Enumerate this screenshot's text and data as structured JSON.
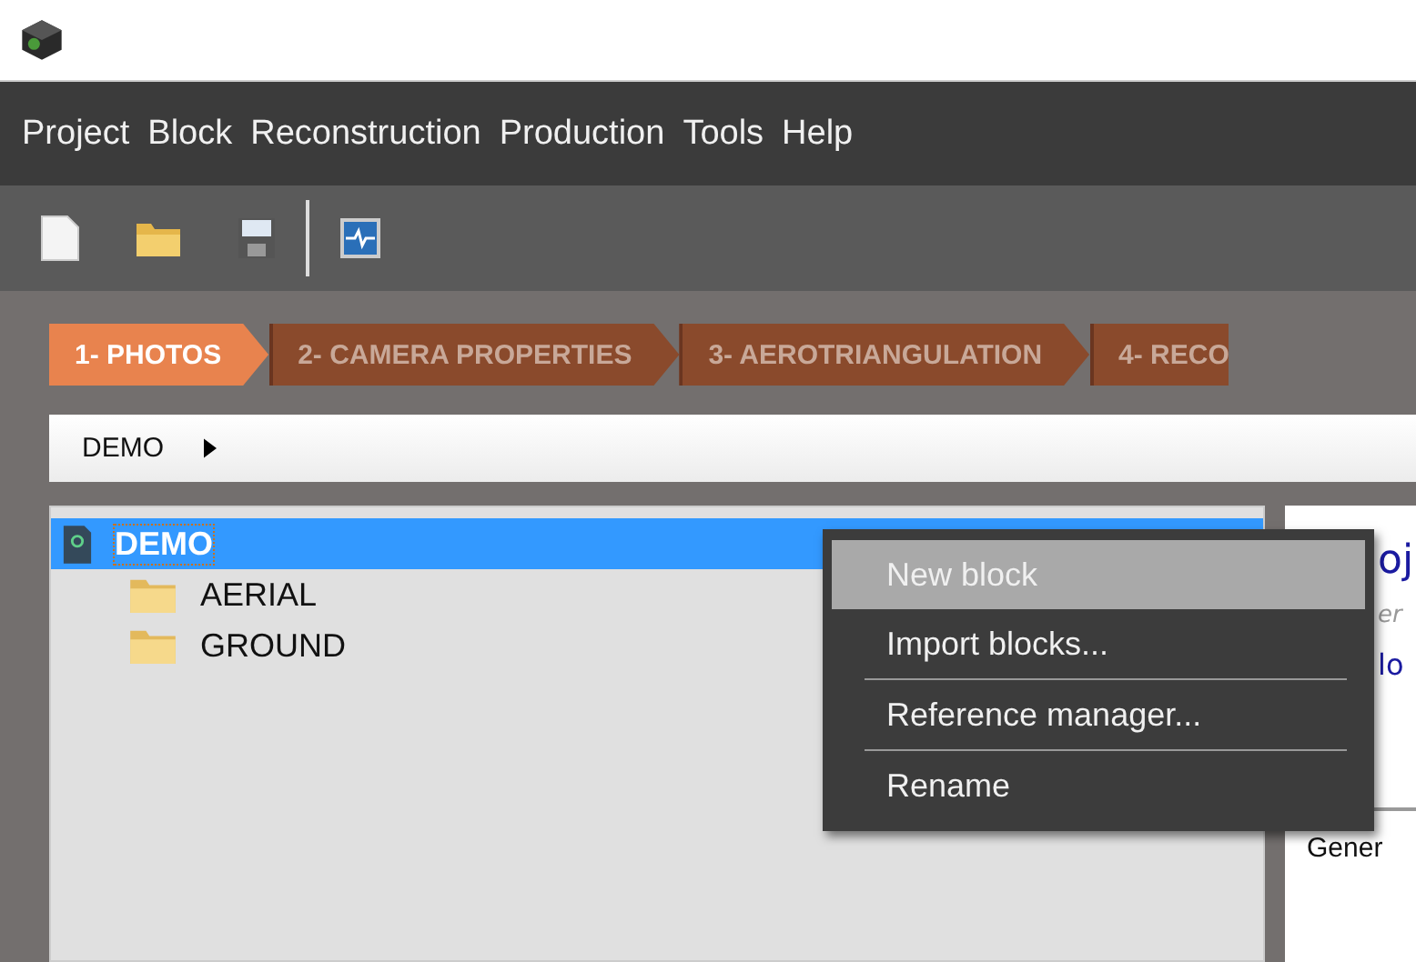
{
  "menu_bar": [
    "Project",
    "Block",
    "Reconstruction",
    "Production",
    "Tools",
    "Help"
  ],
  "tabs": [
    {
      "label": "1- PHOTOS",
      "selected": true
    },
    {
      "label": "2- CAMERA PROPERTIES",
      "selected": false
    },
    {
      "label": "3- AEROTRIANGULATION",
      "selected": false
    },
    {
      "label": "4- RECO",
      "selected": false
    }
  ],
  "breadcrumb": {
    "label": "DEMO"
  },
  "tree": [
    {
      "label": "DEMO",
      "kind": "project",
      "selected": true,
      "children": [
        {
          "label": "AERIAL",
          "kind": "folder",
          "selected": false
        },
        {
          "label": "GROUND",
          "kind": "folder",
          "selected": false
        }
      ]
    }
  ],
  "right_panel": {
    "title": "oj",
    "subtitle": "er",
    "link": "lo",
    "section": "Gener"
  },
  "context_menu": [
    {
      "label": "New block",
      "selected": true,
      "separator": false
    },
    {
      "label": "Import blocks...",
      "selected": false,
      "separator": true
    },
    {
      "label": "Reference manager...",
      "selected": false,
      "separator": true
    },
    {
      "label": "Rename",
      "selected": false,
      "separator": false
    }
  ]
}
